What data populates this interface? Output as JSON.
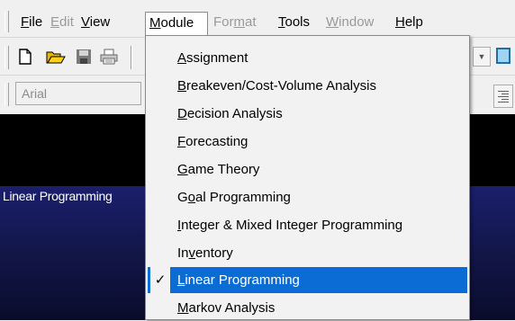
{
  "menubar": {
    "items": [
      {
        "label": "File",
        "mnemonic": "F",
        "rest": "ile",
        "enabled": true
      },
      {
        "label": "Edit",
        "mnemonic": "E",
        "rest": "dit",
        "enabled": false
      },
      {
        "label": "View",
        "mnemonic": "V",
        "rest": "iew",
        "enabled": true
      },
      {
        "label": "Module",
        "mnemonic": "M",
        "rest": "odule",
        "enabled": true,
        "open": true
      },
      {
        "label": "Format",
        "pre": "For",
        "mnemonic": "m",
        "rest": "at",
        "enabled": false
      },
      {
        "label": "Tools",
        "mnemonic": "T",
        "rest": "ools",
        "enabled": true
      },
      {
        "label": "Window",
        "mnemonic": "W",
        "rest": "indow",
        "enabled": false
      },
      {
        "label": "Help",
        "mnemonic": "H",
        "rest": "elp",
        "enabled": true
      }
    ]
  },
  "toolbar": {
    "icons": [
      "new-document-icon",
      "open-folder-icon",
      "save-disk-icon",
      "print-icon"
    ]
  },
  "formatbar": {
    "font_name": "Arial"
  },
  "workspace": {
    "label": "Linear Programming"
  },
  "module_menu": {
    "items": [
      {
        "pre": "",
        "mnemonic": "A",
        "rest": "ssignment",
        "checked": false,
        "selected": false
      },
      {
        "pre": "",
        "mnemonic": "B",
        "rest": "reakeven/Cost-Volume Analysis",
        "checked": false,
        "selected": false
      },
      {
        "pre": "",
        "mnemonic": "D",
        "rest": "ecision Analysis",
        "checked": false,
        "selected": false
      },
      {
        "pre": "",
        "mnemonic": "F",
        "rest": "orecasting",
        "checked": false,
        "selected": false
      },
      {
        "pre": "",
        "mnemonic": "G",
        "rest": "ame Theory",
        "checked": false,
        "selected": false
      },
      {
        "pre": "G",
        "mnemonic": "o",
        "rest": "al Programming",
        "checked": false,
        "selected": false
      },
      {
        "pre": "",
        "mnemonic": "I",
        "rest": "nteger & Mixed Integer Programming",
        "checked": false,
        "selected": false
      },
      {
        "pre": "In",
        "mnemonic": "v",
        "rest": "entory",
        "checked": false,
        "selected": false
      },
      {
        "pre": "",
        "mnemonic": "L",
        "rest": "inear Programming",
        "checked": true,
        "selected": true
      },
      {
        "pre": "",
        "mnemonic": "M",
        "rest": "arkov Analysis",
        "checked": false,
        "selected": false
      }
    ],
    "check_glyph": "✓"
  },
  "colors": {
    "selection": "#0a6cd4",
    "workspace_band": "#1b1f6d",
    "disabled_text": "#9a9a9a"
  }
}
